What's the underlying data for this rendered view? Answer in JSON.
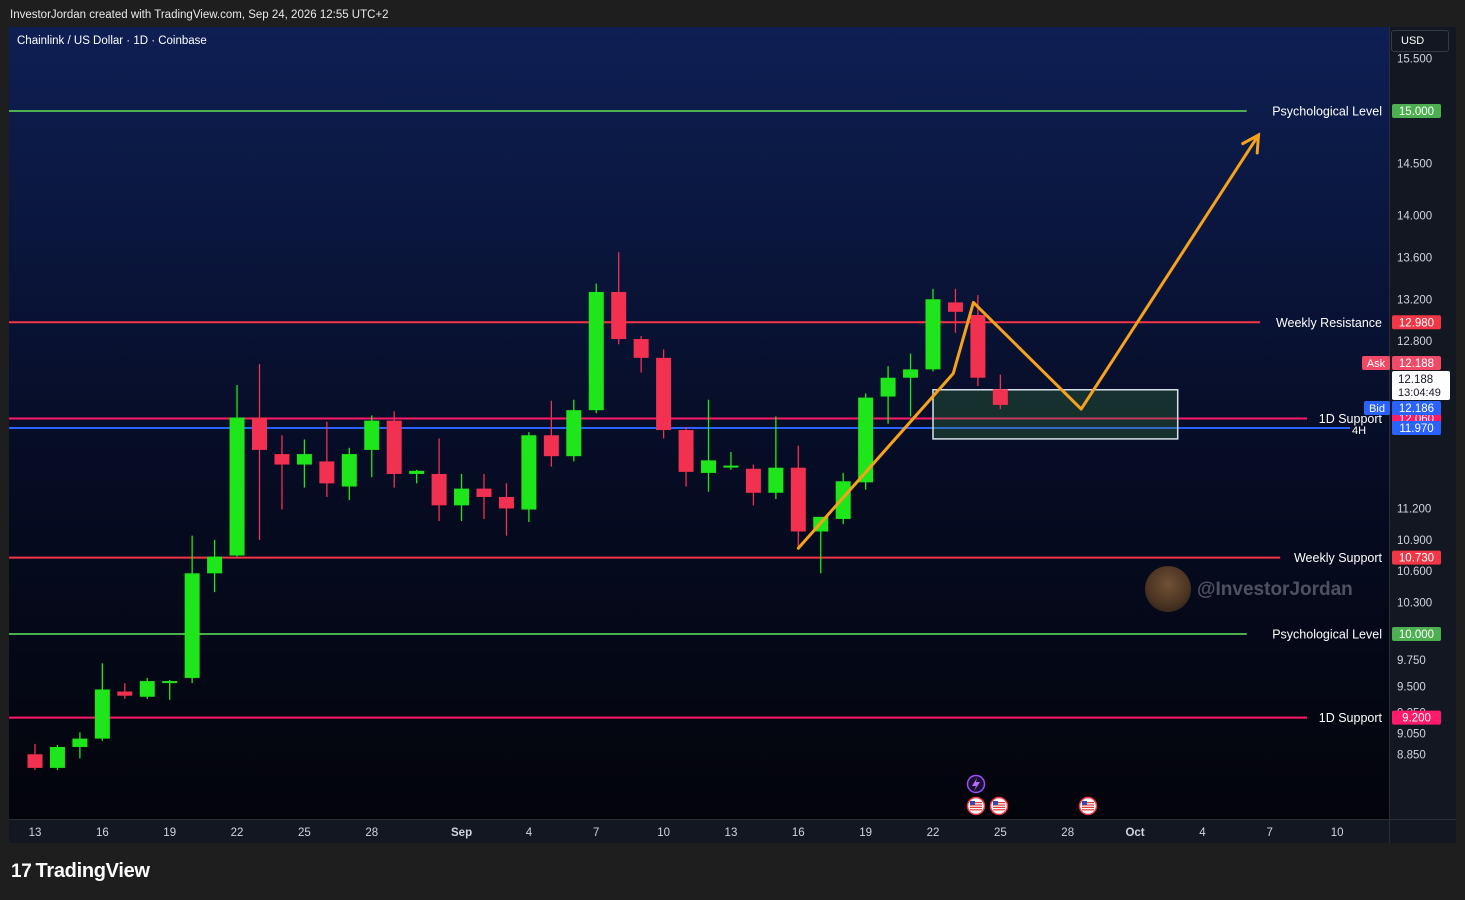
{
  "header": {
    "credit": "InvestorJordan created with TradingView.com, Sep 24, 2026 12:55 UTC+2",
    "symbol_title": "Chainlink / US Dollar · 1D · Coinbase",
    "currency": "USD"
  },
  "footer": {
    "logo_text": "TradingView",
    "logo_mark": "17"
  },
  "watermark": {
    "text": "@InvestorJordan"
  },
  "colors": {
    "up": "#1ee61a",
    "down": "#f2304f",
    "psych": "#4caf50",
    "resistance": "#f23645",
    "support_1d": "#ff1a6a",
    "bid": "#2962ff",
    "projection": "#f7a21b"
  },
  "chart_data": {
    "type": "candlestick",
    "title": "Chainlink / US Dollar · 1D · Coinbase",
    "ylim": [
      8.7,
      15.8
    ],
    "yticks": [
      "15.500",
      "14.500",
      "14.000",
      "13.600",
      "13.200",
      "12.800",
      "12.400",
      "11.200",
      "10.900",
      "10.600",
      "10.300",
      "9.750",
      "9.500",
      "9.250",
      "9.050",
      "8.850"
    ],
    "xticks": [
      {
        "label": "13",
        "i": 0
      },
      {
        "label": "16",
        "i": 3
      },
      {
        "label": "19",
        "i": 6
      },
      {
        "label": "22",
        "i": 9
      },
      {
        "label": "25",
        "i": 12
      },
      {
        "label": "28",
        "i": 15
      },
      {
        "label": "Sep",
        "i": 19
      },
      {
        "label": "4",
        "i": 22
      },
      {
        "label": "7",
        "i": 25
      },
      {
        "label": "10",
        "i": 28
      },
      {
        "label": "13",
        "i": 31
      },
      {
        "label": "16",
        "i": 34
      },
      {
        "label": "19",
        "i": 37
      },
      {
        "label": "22",
        "i": 40
      },
      {
        "label": "25",
        "i": 43
      },
      {
        "label": "28",
        "i": 46
      },
      {
        "label": "Oct",
        "i": 49
      },
      {
        "label": "4",
        "i": 52
      },
      {
        "label": "7",
        "i": 55
      },
      {
        "label": "10",
        "i": 58
      }
    ],
    "candles": [
      {
        "o": 8.85,
        "h": 8.95,
        "l": 8.7,
        "c": 8.72
      },
      {
        "o": 8.72,
        "h": 8.94,
        "l": 8.7,
        "c": 8.92
      },
      {
        "o": 8.92,
        "h": 9.06,
        "l": 8.81,
        "c": 9.0
      },
      {
        "o": 9.0,
        "h": 9.72,
        "l": 8.98,
        "c": 9.47
      },
      {
        "o": 9.45,
        "h": 9.53,
        "l": 9.38,
        "c": 9.41
      },
      {
        "o": 9.4,
        "h": 9.58,
        "l": 9.38,
        "c": 9.55
      },
      {
        "o": 9.55,
        "h": 9.56,
        "l": 9.37,
        "c": 9.55
      },
      {
        "o": 9.58,
        "h": 10.94,
        "l": 9.53,
        "c": 10.58
      },
      {
        "o": 10.58,
        "h": 10.9,
        "l": 10.4,
        "c": 10.74
      },
      {
        "o": 10.75,
        "h": 12.38,
        "l": 10.74,
        "c": 12.07
      },
      {
        "o": 12.07,
        "h": 12.58,
        "l": 10.9,
        "c": 11.76
      },
      {
        "o": 11.72,
        "h": 11.9,
        "l": 11.19,
        "c": 11.62
      },
      {
        "o": 11.62,
        "h": 11.86,
        "l": 11.4,
        "c": 11.72
      },
      {
        "o": 11.65,
        "h": 12.03,
        "l": 11.31,
        "c": 11.44
      },
      {
        "o": 11.41,
        "h": 11.78,
        "l": 11.28,
        "c": 11.72
      },
      {
        "o": 11.76,
        "h": 12.09,
        "l": 11.5,
        "c": 12.04
      },
      {
        "o": 12.04,
        "h": 12.13,
        "l": 11.4,
        "c": 11.53
      },
      {
        "o": 11.53,
        "h": 11.57,
        "l": 11.44,
        "c": 11.56
      },
      {
        "o": 11.53,
        "h": 11.87,
        "l": 11.08,
        "c": 11.23
      },
      {
        "o": 11.23,
        "h": 11.53,
        "l": 11.08,
        "c": 11.39
      },
      {
        "o": 11.39,
        "h": 11.53,
        "l": 11.1,
        "c": 11.31
      },
      {
        "o": 11.31,
        "h": 11.44,
        "l": 10.94,
        "c": 11.2
      },
      {
        "o": 11.19,
        "h": 11.93,
        "l": 11.07,
        "c": 11.9
      },
      {
        "o": 11.9,
        "h": 12.23,
        "l": 11.6,
        "c": 11.7
      },
      {
        "o": 11.7,
        "h": 12.24,
        "l": 11.65,
        "c": 12.14
      },
      {
        "o": 12.14,
        "h": 13.35,
        "l": 12.11,
        "c": 13.27
      },
      {
        "o": 13.27,
        "h": 13.65,
        "l": 12.77,
        "c": 12.82
      },
      {
        "o": 12.82,
        "h": 12.85,
        "l": 12.5,
        "c": 12.64
      },
      {
        "o": 12.64,
        "h": 12.72,
        "l": 11.87,
        "c": 11.95
      },
      {
        "o": 11.95,
        "h": 11.98,
        "l": 11.41,
        "c": 11.55
      },
      {
        "o": 11.54,
        "h": 12.24,
        "l": 11.36,
        "c": 11.66
      },
      {
        "o": 11.61,
        "h": 11.74,
        "l": 11.57,
        "c": 11.61
      },
      {
        "o": 11.58,
        "h": 11.62,
        "l": 11.23,
        "c": 11.35
      },
      {
        "o": 11.35,
        "h": 12.08,
        "l": 11.29,
        "c": 11.59
      },
      {
        "o": 11.59,
        "h": 11.8,
        "l": 10.84,
        "c": 10.98
      },
      {
        "o": 10.98,
        "h": 11.09,
        "l": 10.58,
        "c": 11.12
      },
      {
        "o": 11.1,
        "h": 11.54,
        "l": 11.05,
        "c": 11.46
      },
      {
        "o": 11.45,
        "h": 12.3,
        "l": 11.38,
        "c": 12.26
      },
      {
        "o": 12.27,
        "h": 12.56,
        "l": 12.01,
        "c": 12.45
      },
      {
        "o": 12.45,
        "h": 12.68,
        "l": 12.08,
        "c": 12.53
      },
      {
        "o": 12.53,
        "h": 13.3,
        "l": 12.51,
        "c": 13.2
      },
      {
        "o": 13.17,
        "h": 13.3,
        "l": 12.88,
        "c": 13.08
      },
      {
        "o": 13.05,
        "h": 13.24,
        "l": 12.37,
        "c": 12.45
      },
      {
        "o": 12.34,
        "h": 12.48,
        "l": 12.15,
        "c": 12.19
      }
    ],
    "levels": [
      {
        "label": "Psychological Level",
        "value": 15.0,
        "tag": "15.000",
        "style": "psych"
      },
      {
        "label": "Weekly Resistance",
        "value": 12.98,
        "tag": "12.980",
        "style": "resistance"
      },
      {
        "label": "1D Support",
        "value": 12.06,
        "tag": "12.060",
        "style": "support_1d"
      },
      {
        "label": "Weekly Support",
        "value": 10.73,
        "tag": "10.730",
        "style": "resistance"
      },
      {
        "label": "Psychological Level",
        "value": 10.0,
        "tag": "10.000",
        "style": "psych"
      },
      {
        "label": "1D Support",
        "value": 9.2,
        "tag": "9.200",
        "style": "support_1d"
      }
    ],
    "bid_line": {
      "value": 11.97,
      "tag": "11.970"
    },
    "price_box": {
      "ask_label": "Ask",
      "ask": "12.188",
      "price": "12.188",
      "countdown": "13:04:49",
      "bid_label": "Bid",
      "bid": "12.186"
    },
    "zone": {
      "i0": 40.0,
      "i1": 50.9,
      "y0": 11.865,
      "y1": 12.335
    },
    "projection_path": [
      {
        "i": 34.0,
        "y": 10.82
      },
      {
        "i": 40.9,
        "y": 12.49
      },
      {
        "i": 41.8,
        "y": 13.17
      },
      {
        "i": 46.6,
        "y": 12.15
      },
      {
        "i": 54.5,
        "y": 14.77
      }
    ],
    "tick_label_4h": "4H"
  }
}
